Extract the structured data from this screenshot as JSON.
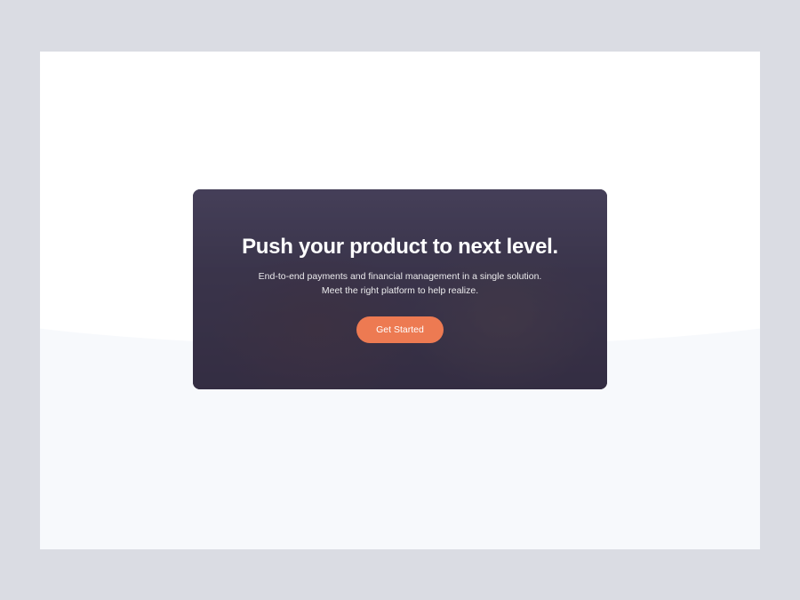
{
  "hero": {
    "title": "Push your product to next level.",
    "subtitle": "End-to-end payments and financial management in a single solution. Meet the right platform to help realize.",
    "cta_label": "Get Started"
  },
  "colors": {
    "accent": "#ed7a52",
    "page_bg": "#dadce3",
    "card_bg": "#ffffff",
    "wave_bg": "#f7f9fc"
  }
}
